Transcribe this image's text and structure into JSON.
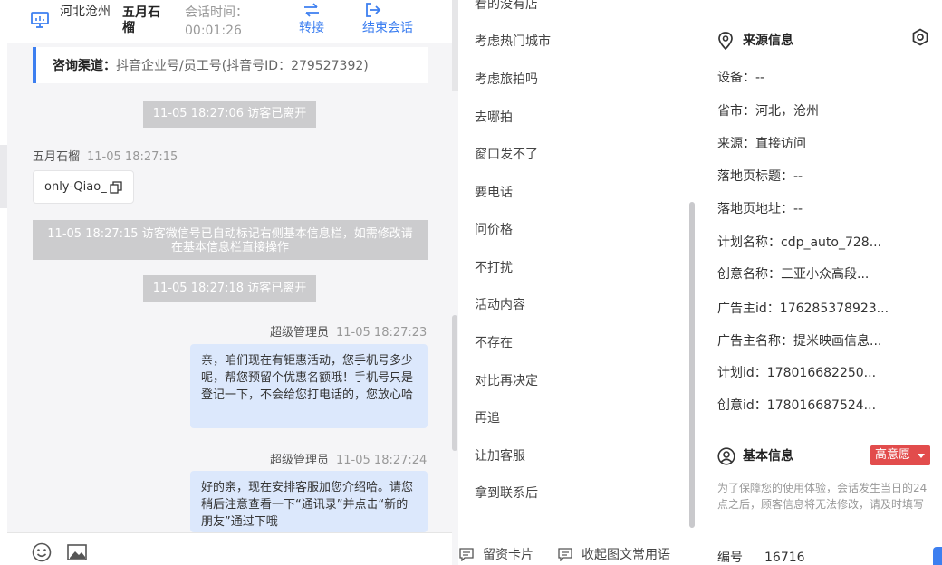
{
  "header": {
    "location": "河北沧州",
    "visitor_name": "五月石榴",
    "session_time_label": "会话时间：",
    "session_time": "00:01:26",
    "transfer_label": "转接",
    "end_label": "结束会话"
  },
  "channel": {
    "label": "咨询渠道：",
    "value": "抖音企业号/员工号(抖音号ID：279527392)"
  },
  "messages": {
    "sys1": "11-05 18:27:06 访客已离开",
    "visitor_name": "五月石榴",
    "visitor_time": "11-05 18:27:15",
    "visitor_text": "only-Qiao_",
    "sys2": "11-05 18:27:15 访客微信号已自动标记右侧基本信息栏，如需修改请在基本信息栏直接操作",
    "sys3": "11-05 18:27:18 访客已离开",
    "agent1_name": "超级管理员",
    "agent1_time": "11-05 18:27:23",
    "agent1_text": "亲，咱们现在有钜惠活动，您手机号多少呢，帮您预留个优惠名额哦！手机号只是登记一下，不会给您打电话的，您放心哈",
    "agent2_name": "超级管理员",
    "agent2_time": "11-05 18:27:24",
    "agent2_text": "好的亲，现在安排客服加您介绍哈。请您稍后注意查看一下“通讯录”并点击“新的朋友”通过下哦"
  },
  "quick_replies": [
    "看的没有店",
    "考虑热门城市",
    "考虑旅拍吗",
    "去哪拍",
    "窗口发不了",
    "要电话",
    "问价格",
    "不打扰",
    "活动内容",
    "不存在",
    "对比再决定",
    "再追",
    "让加客服",
    "拿到联系后"
  ],
  "mid_bottom": {
    "card_label": "留资卡片",
    "collect_label": "收起图文常用语"
  },
  "source_info": {
    "title": "来源信息",
    "rows": [
      {
        "k": "设备：",
        "v": "--"
      },
      {
        "k": "省市：",
        "v": "河北，沧州"
      },
      {
        "k": "来源：",
        "v": "直接访问"
      },
      {
        "k": "落地页标题：",
        "v": "--"
      },
      {
        "k": "落地页地址：",
        "v": "--"
      },
      {
        "k": "计划名称：",
        "v": "cdp_auto_728..."
      },
      {
        "k": "创意名称：",
        "v": "三亚小众高段..."
      },
      {
        "k": "广告主id：",
        "v": "176285378923..."
      },
      {
        "k": "广告主名称：",
        "v": "提米映画信息..."
      },
      {
        "k": "计划id：",
        "v": "178016682250..."
      },
      {
        "k": "创意id：",
        "v": "178016687524..."
      }
    ]
  },
  "basic_info": {
    "title": "基本信息",
    "intent_badge": "高意愿",
    "notice": "为了保障您的使用体验，会话发生当日的24点之后，顾客信息将无法修改，请及时填写",
    "id_label": "编号",
    "id_value": "16716"
  },
  "colors": {
    "accent": "#3d7ff0",
    "bubble_agent": "#dce8fc",
    "system_msg": "#ccccce",
    "badge_red": "#e24c4c"
  }
}
